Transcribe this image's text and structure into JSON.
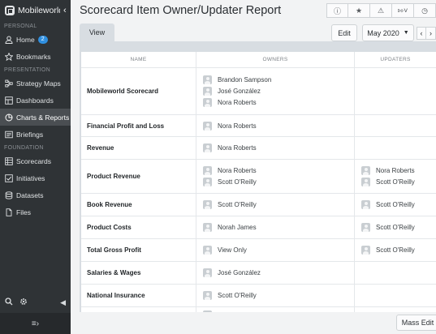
{
  "app": {
    "name": "Mobileworld"
  },
  "sidebar": {
    "sections": [
      {
        "label": "PERSONAL",
        "items": [
          {
            "label": "Home",
            "icon": "user-icon",
            "badge": "2"
          },
          {
            "label": "Bookmarks",
            "icon": "star-icon"
          }
        ]
      },
      {
        "label": "PRESENTATION",
        "items": [
          {
            "label": "Strategy Maps",
            "icon": "map-icon"
          },
          {
            "label": "Dashboards",
            "icon": "dashboard-icon"
          },
          {
            "label": "Charts & Reports",
            "icon": "pie-chart-icon",
            "active": true
          },
          {
            "label": "Briefings",
            "icon": "briefing-icon"
          }
        ]
      },
      {
        "label": "FOUNDATION",
        "items": [
          {
            "label": "Scorecards",
            "icon": "scorecard-icon"
          },
          {
            "label": "Initiatives",
            "icon": "checkbox-icon"
          },
          {
            "label": "Datasets",
            "icon": "database-icon"
          },
          {
            "label": "Files",
            "icon": "file-icon"
          }
        ]
      }
    ]
  },
  "header": {
    "title": "Scorecard Item Owner/Updater Report"
  },
  "toolbar": {
    "icons": [
      "info-icon",
      "star-icon",
      "warning-icon",
      "share-icon",
      "clock-icon"
    ]
  },
  "tabs": {
    "view": "View"
  },
  "controls": {
    "edit": "Edit",
    "period": "May 2020",
    "prev": "‹",
    "next": "›",
    "mass_edit": "Mass Edit"
  },
  "table": {
    "columns": [
      "NAME",
      "OWNERS",
      "UPDATERS"
    ],
    "rows": [
      {
        "name": "Mobileworld Scorecard",
        "owners": [
          "Brandon Sampson",
          "José González",
          "Nora Roberts"
        ],
        "updaters": []
      },
      {
        "name": "Financial Profit and Loss",
        "owners": [
          "Nora Roberts"
        ],
        "updaters": []
      },
      {
        "name": "Revenue",
        "owners": [
          "Nora Roberts"
        ],
        "updaters": []
      },
      {
        "name": "Product Revenue",
        "owners": [
          "Nora Roberts",
          "Scott O'Reilly"
        ],
        "updaters": [
          "Nora Roberts",
          "Scott O'Reilly"
        ]
      },
      {
        "name": "Book Revenue",
        "owners": [
          "Scott O'Reilly"
        ],
        "updaters": [
          "Scott O'Reilly"
        ]
      },
      {
        "name": "Product Costs",
        "owners": [
          "Norah James"
        ],
        "updaters": [
          "Scott O'Reilly"
        ]
      },
      {
        "name": "Total Gross Profit",
        "owners": [
          "View Only"
        ],
        "updaters": [
          "Scott O'Reilly"
        ]
      },
      {
        "name": "Salaries & Wages",
        "owners": [
          "José González"
        ],
        "updaters": []
      },
      {
        "name": "National Insurance",
        "owners": [
          "Scott O'Reilly"
        ],
        "updaters": []
      },
      {
        "name": "",
        "owners": [
          ""
        ],
        "updaters": []
      }
    ]
  }
}
